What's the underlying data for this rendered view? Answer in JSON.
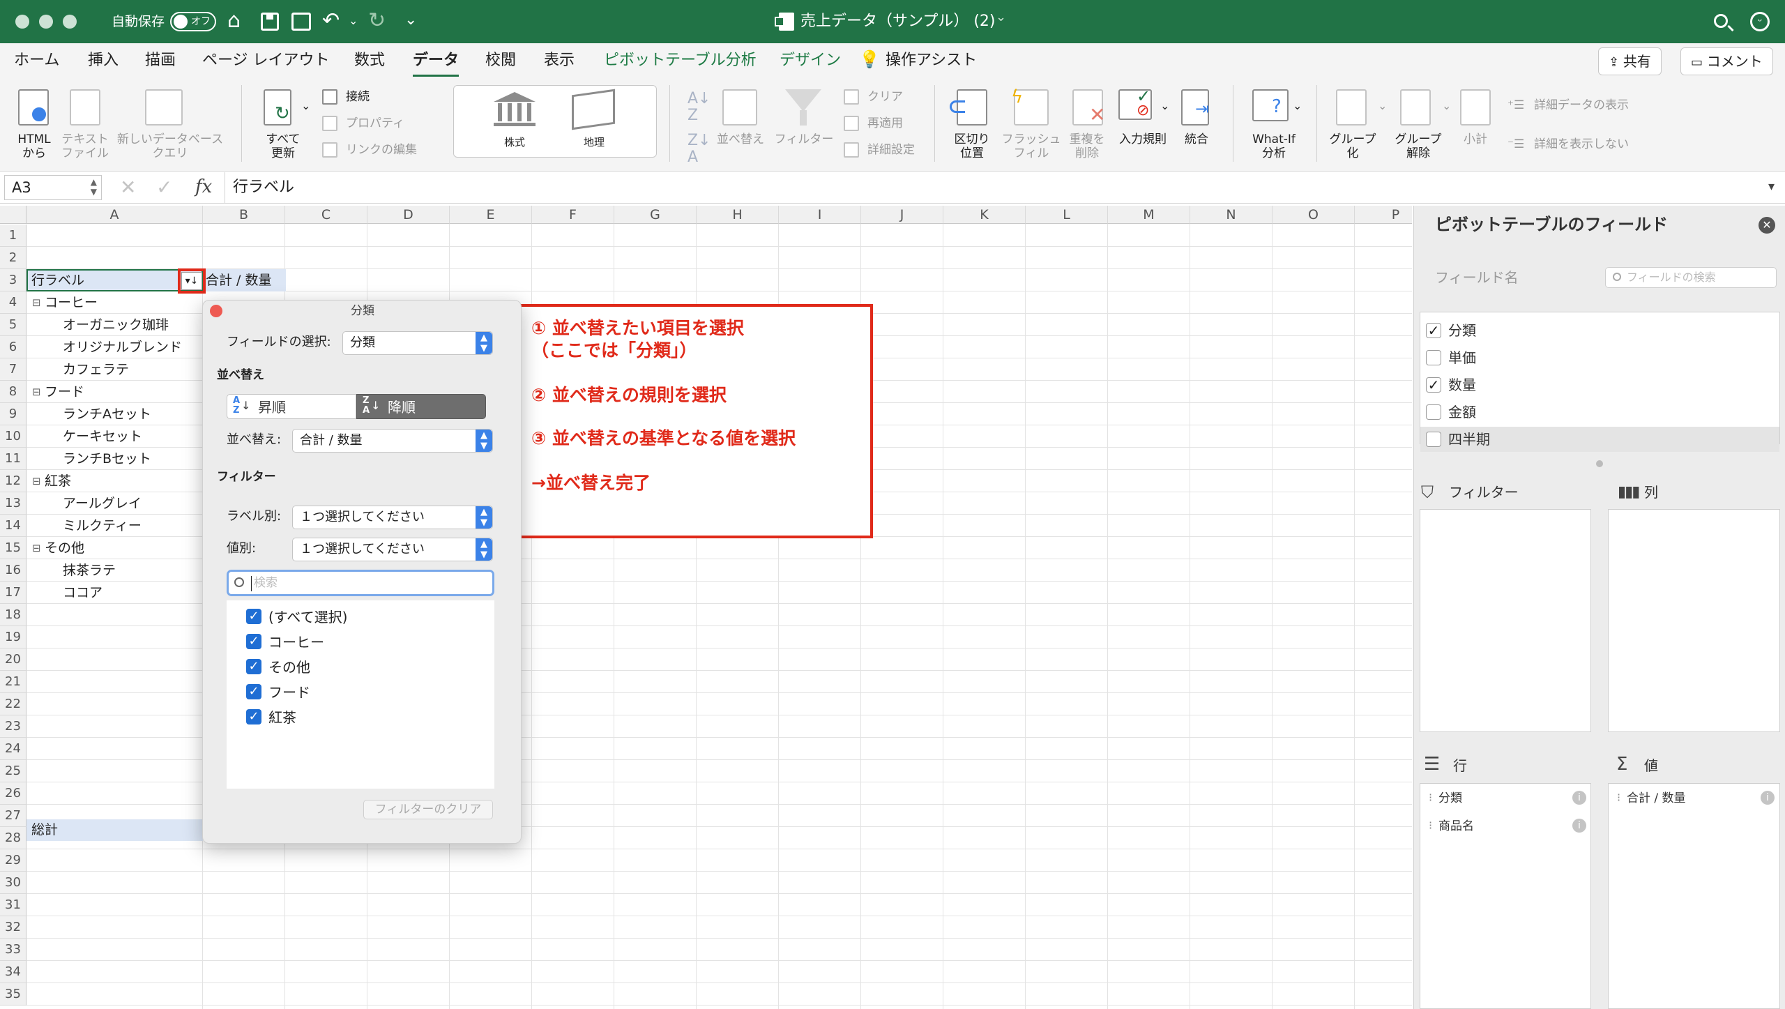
{
  "window": {
    "title": "売上データ（サンプル） (2)",
    "autosave_label": "自動保存",
    "autosave_state": "オフ"
  },
  "tabs": [
    "ホーム",
    "挿入",
    "描画",
    "ページ レイアウト",
    "数式",
    "データ",
    "校閲",
    "表示",
    "ピボットテーブル分析",
    "デザイン",
    "操作アシスト"
  ],
  "active_tab": "データ",
  "top_buttons": {
    "share": "共有",
    "comment": "コメント"
  },
  "ribbon": {
    "get_data": [
      "HTML\nから",
      "テキスト\nファイル",
      "新しいデータベース\nクエリ"
    ],
    "refresh_all": "すべて\n更新",
    "connections": [
      "接続",
      "プロパティ",
      "リンクの編集"
    ],
    "data_types": [
      "株式",
      "地理"
    ],
    "sort_filter": [
      "並べ替え",
      "フィルター"
    ],
    "filter_small": [
      "クリア",
      "再適用",
      "詳細設定"
    ],
    "tools": [
      "区切り\n位置",
      "フラッシュ\nフィル",
      "重複を\n削除",
      "入力規則",
      "統合"
    ],
    "what_if": "What-If\n分析",
    "outline": [
      "グループ\n化",
      "グループ\n解除",
      "小計"
    ],
    "detail": [
      "詳細データの表示",
      "詳細を表示しない"
    ]
  },
  "formula_bar": {
    "cell_ref": "A3",
    "content": "行ラベル",
    "fx": "fx"
  },
  "columns": [
    "A",
    "B",
    "C",
    "D",
    "E",
    "F",
    "G",
    "H",
    "I",
    "J",
    "K",
    "L",
    "M",
    "N",
    "O",
    "P"
  ],
  "rows": [
    "1",
    "2",
    "3",
    "4",
    "5",
    "6",
    "7",
    "8",
    "9",
    "10",
    "11",
    "12",
    "13",
    "14",
    "15",
    "16",
    "17",
    "18",
    "19",
    "20",
    "21",
    "22",
    "23",
    "24",
    "25",
    "26",
    "27",
    "28",
    "29",
    "30",
    "31",
    "32",
    "33",
    "34",
    "35"
  ],
  "pivot": {
    "header_label": "行ラベル",
    "header_value": "合計 / 数量",
    "items": [
      {
        "text": "コーヒー",
        "level": 0
      },
      {
        "text": "オーガニック珈琲",
        "level": 1
      },
      {
        "text": "オリジナルブレンド",
        "level": 1
      },
      {
        "text": "カフェラテ",
        "level": 1
      },
      {
        "text": "フード",
        "level": 0
      },
      {
        "text": "ランチAセット",
        "level": 1
      },
      {
        "text": "ケーキセット",
        "level": 1
      },
      {
        "text": "ランチBセット",
        "level": 1
      },
      {
        "text": "紅茶",
        "level": 0
      },
      {
        "text": "アールグレイ",
        "level": 1
      },
      {
        "text": "ミルクティー",
        "level": 1
      },
      {
        "text": "その他",
        "level": 0
      },
      {
        "text": "抹茶ラテ",
        "level": 1
      },
      {
        "text": "ココア",
        "level": 1
      }
    ],
    "total": "総計",
    "collapse_glyph": "⊟"
  },
  "popup": {
    "title": "分類",
    "field_select_label": "フィールドの選択:",
    "field_select_value": "分類",
    "sort_section": "並べ替え",
    "asc": "昇順",
    "desc": "降順",
    "sort_by_label": "並べ替え:",
    "sort_by_value": "合計 / 数量",
    "filter_section": "フィルター",
    "label_filter_label": "ラベル別:",
    "label_filter_value": "１つ選択してください",
    "value_filter_label": "値別:",
    "value_filter_value": "１つ選択してください",
    "search_placeholder": "検索",
    "list_items": [
      "(すべて選択)",
      "コーヒー",
      "その他",
      "フード",
      "紅茶"
    ],
    "clear_filter": "フィルターのクリア"
  },
  "annotations": {
    "step1_line1": "① 並べ替えたい項目を選択",
    "step1_line2": "（ここでは「分類」）",
    "step2": "② 並べ替えの規則を選択",
    "step3": "③ 並べ替えの基準となる値を選択",
    "done": "→並べ替え完了",
    "color": "#e02a1a"
  },
  "pivot_pane": {
    "title": "ピボットテーブルのフィールド",
    "field_name_label": "フィールド名",
    "search_placeholder": "フィールドの検索",
    "fields": [
      {
        "name": "分類",
        "checked": true
      },
      {
        "name": "単価",
        "checked": false
      },
      {
        "name": "数量",
        "checked": true
      },
      {
        "name": "金額",
        "checked": false
      },
      {
        "name": "四半期",
        "checked": false
      }
    ],
    "filters_label": "フィルター",
    "columns_label": "列",
    "rows_label": "行",
    "values_label": "値",
    "rows_items": [
      "分類",
      "商品名"
    ],
    "values_items": [
      "合計 / 数量"
    ]
  },
  "colors": {
    "brand_green": "#217346",
    "select_blue": "#dce6f5",
    "accent_blue": "#1f6ed4"
  }
}
